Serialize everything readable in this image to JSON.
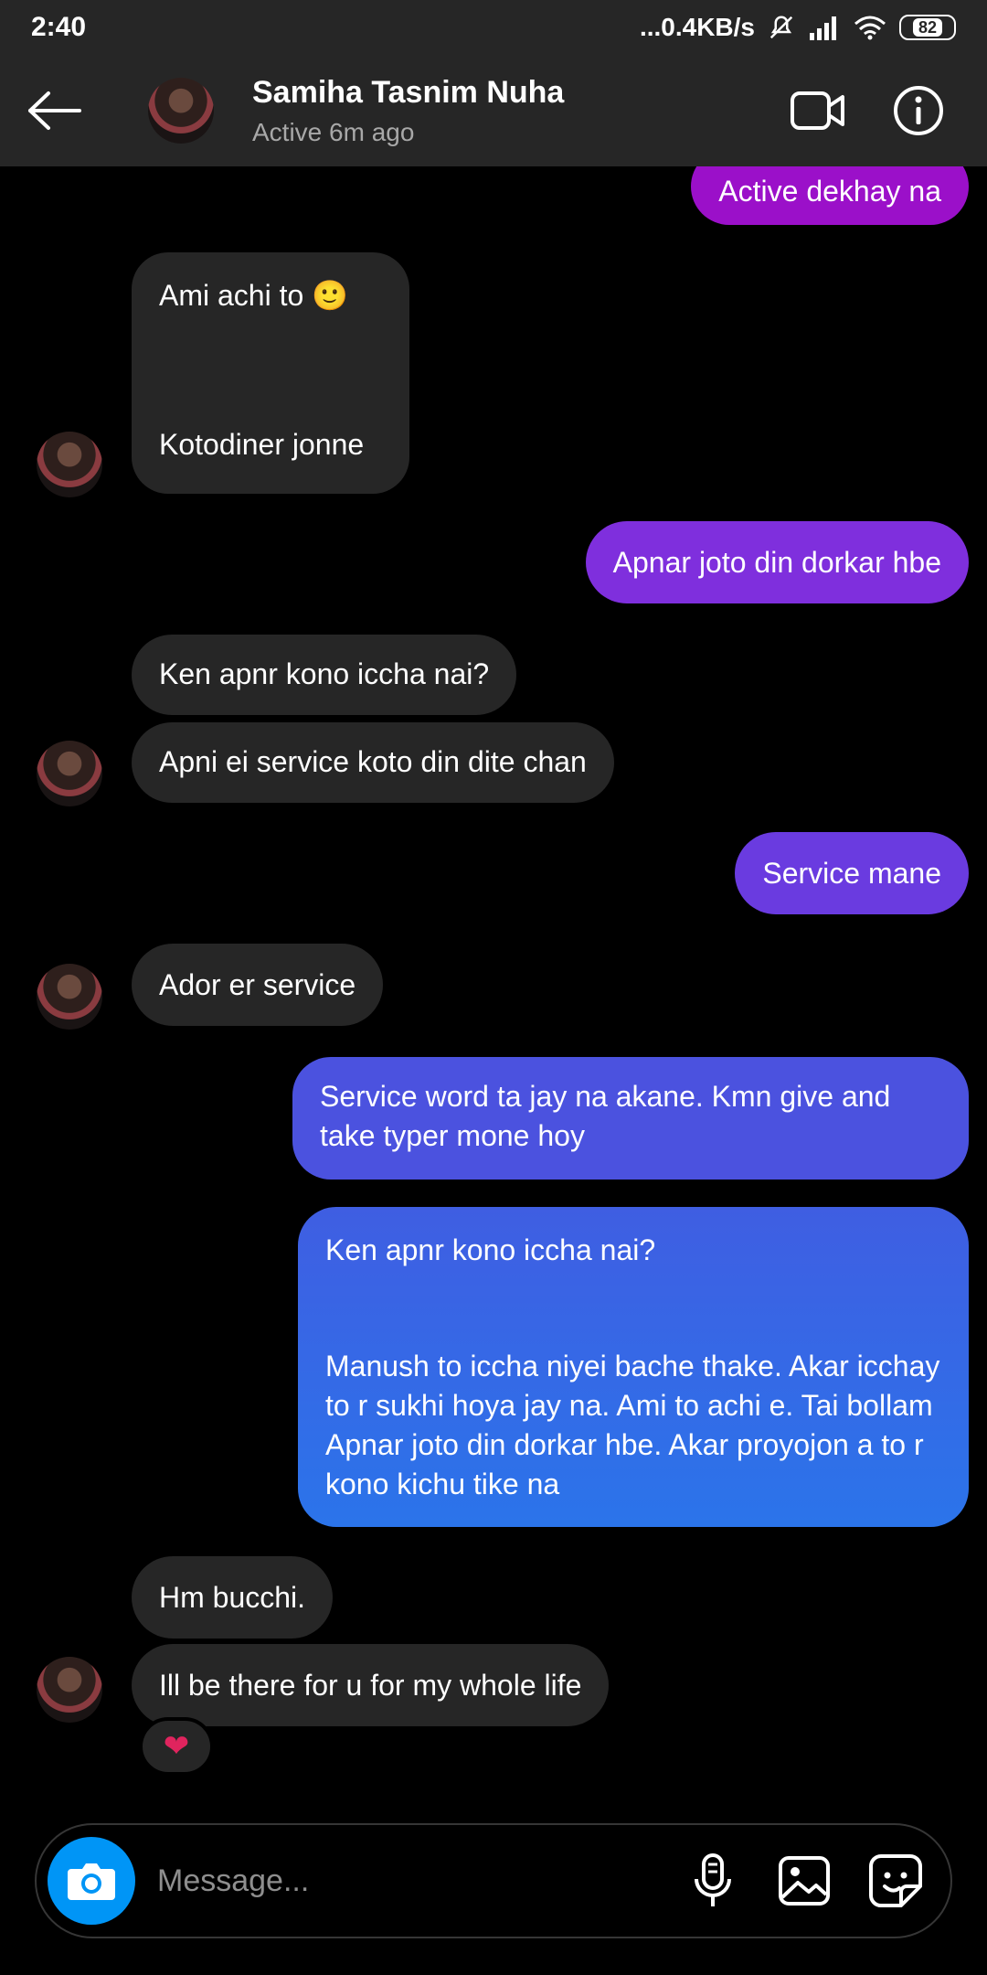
{
  "status_bar": {
    "time": "2:40",
    "network_speed": "...0.4KB/s",
    "battery": "82"
  },
  "header": {
    "contact_name": "Samiha Tasnim Nuha",
    "contact_status": "Active 6m ago",
    "icons": [
      "back-arrow-icon",
      "video-call-icon",
      "info-icon"
    ]
  },
  "messages": [
    {
      "side": "out",
      "text": "Active dekhay na",
      "color": "#9b10c9"
    },
    {
      "side": "in",
      "text": "Ami achi to 🙂",
      "text2": "Kotodiner jonne"
    },
    {
      "side": "out",
      "text": "Apnar joto din dorkar hbe",
      "color": "#7f2fdd"
    },
    {
      "side": "in",
      "text": "Ken apnr kono iccha nai?"
    },
    {
      "side": "in",
      "text": "Apni ei service koto din dite chan"
    },
    {
      "side": "out",
      "text": "Service mane",
      "color": "#6a3be0"
    },
    {
      "side": "in",
      "text": "Ador er service"
    },
    {
      "side": "out",
      "text": "Service word ta jay na akane. Kmn give and take typer mone hoy",
      "color": "#4b52df"
    },
    {
      "side": "out",
      "text": "Ken apnr kono iccha nai?",
      "text2": "Manush to iccha niyei bache thake. Akar icchay to r sukhi hoya jay na. Ami to achi e. Tai bollam Apnar joto din dorkar hbe. Akar proyojon a to r kono kichu tike na",
      "color": "#2f6ee8"
    },
    {
      "side": "in",
      "text": "Hm bucchi."
    },
    {
      "side": "in",
      "text": "Ill be there for u for my whole life",
      "reaction": "❤"
    }
  ],
  "composer": {
    "placeholder": "Message...",
    "icons": [
      "camera-icon",
      "microphone-icon",
      "gallery-icon",
      "sticker-icon"
    ]
  }
}
